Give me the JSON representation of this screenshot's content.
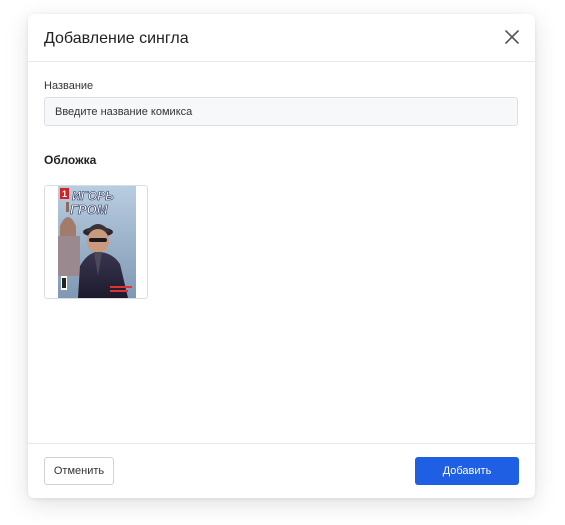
{
  "dialog": {
    "title": "Добавление сингла",
    "close_icon": "close-icon"
  },
  "form": {
    "name_label": "Название",
    "name_placeholder": "Введите название комикса",
    "name_value": "",
    "cover_label": "Обложка"
  },
  "cover": {
    "issue_number": "1",
    "title_line1": "ИГОРЬ",
    "title_line2": "ГРОМ"
  },
  "footer": {
    "cancel_label": "Отменить",
    "add_label": "Добавить"
  },
  "colors": {
    "primary": "#1f5fe3",
    "border": "#dcdfe3",
    "text": "#222222"
  }
}
